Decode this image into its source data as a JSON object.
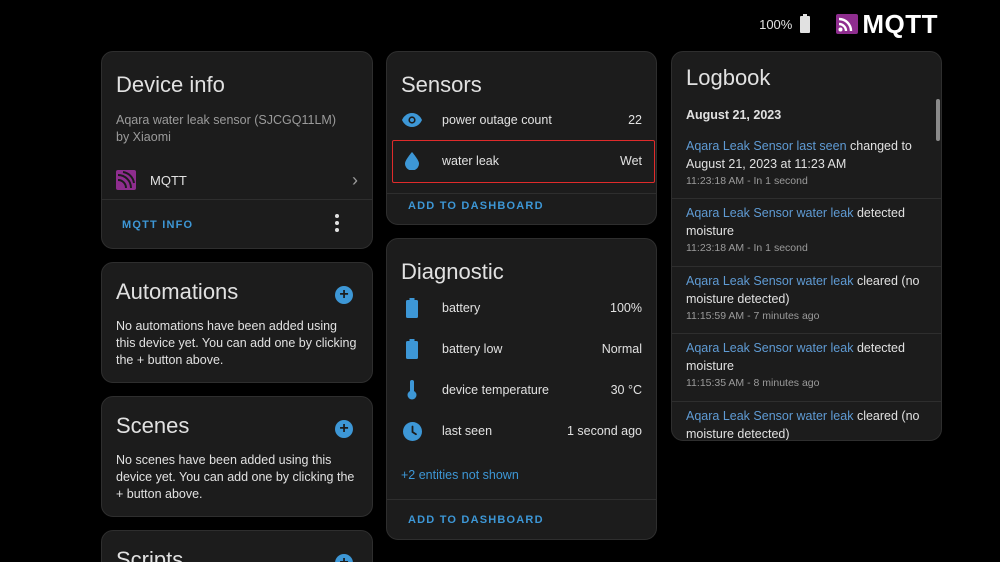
{
  "topbar": {
    "battery": "100%",
    "logo_text": "MQTT",
    "logo_color": "#8e2d8e"
  },
  "device_info": {
    "title": "Device info",
    "model": "Aqara water leak sensor (SJCGQ11LM)",
    "manufacturer": "by Xiaomi",
    "integration_label": "MQTT",
    "action_label": "MQTT INFO"
  },
  "automations": {
    "title": "Automations",
    "text": "No automations have been added using this device yet. You can add one by clicking the + button above."
  },
  "scenes": {
    "title": "Scenes",
    "text": "No scenes have been added using this device yet. You can add one by clicking the + button above."
  },
  "scripts": {
    "title": "Scripts"
  },
  "sensors": {
    "title": "Sensors",
    "rows": [
      {
        "icon": "eye-icon",
        "name": "power outage count",
        "value": "22"
      },
      {
        "icon": "water-drop-icon",
        "name": "water leak",
        "value": "Wet"
      }
    ],
    "action_label": "ADD TO DASHBOARD"
  },
  "diagnostic": {
    "title": "Diagnostic",
    "rows": [
      {
        "icon": "battery-icon",
        "name": "battery",
        "value": "100%"
      },
      {
        "icon": "battery-icon",
        "name": "battery low",
        "value": "Normal"
      },
      {
        "icon": "thermometer-icon",
        "name": "device temperature",
        "value": "30 °C"
      },
      {
        "icon": "clock-icon",
        "name": "last seen",
        "value": "1 second ago"
      }
    ],
    "more_link": "+2 entities not shown",
    "action_label": "ADD TO DASHBOARD"
  },
  "logbook": {
    "title": "Logbook",
    "date": "August 21, 2023",
    "entries": [
      {
        "entity": "Aqara Leak Sensor last seen",
        "text": " changed to August 21, 2023 at 11:23 AM",
        "time": "11:23:18 AM - In 1 second"
      },
      {
        "entity": "Aqara Leak Sensor water leak",
        "text": " detected moisture",
        "time": "11:23:18 AM - In 1 second"
      },
      {
        "entity": "Aqara Leak Sensor water leak",
        "text": " cleared (no moisture detected)",
        "time": "11:15:59 AM - 7 minutes ago"
      },
      {
        "entity": "Aqara Leak Sensor water leak",
        "text": " detected moisture",
        "time": "11:15:35 AM - 8 minutes ago"
      },
      {
        "entity": "Aqara Leak Sensor water leak",
        "text": " cleared (no moisture detected)",
        "time": ""
      }
    ]
  },
  "colors": {
    "accent": "#3d97d6",
    "icon": "#3d97d6",
    "highlight": "#e02b2b",
    "card": "#1c1c1c"
  }
}
